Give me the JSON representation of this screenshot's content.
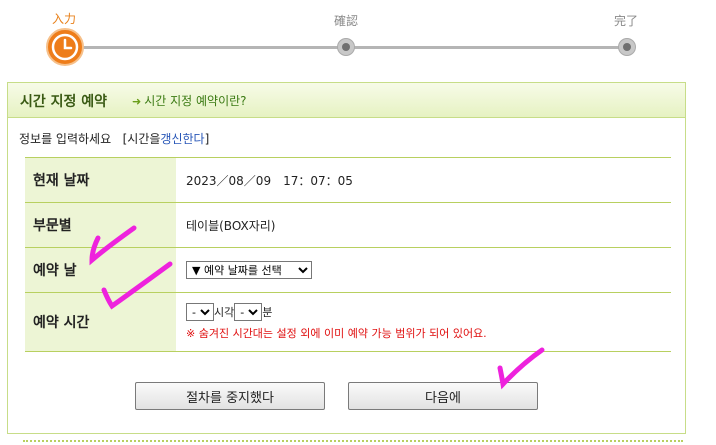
{
  "steps": {
    "input": "入力",
    "confirm": "確認",
    "done": "完了"
  },
  "panel": {
    "title": "시간 지정 예약",
    "help_link": "시간 지정 예약이란?"
  },
  "intro": {
    "text": "정보를 입력하세요",
    "refresh_prefix": "[시간을",
    "refresh_link": "갱신한다",
    "refresh_suffix": "]"
  },
  "rows": {
    "current_date": {
      "label": "현재 날짜",
      "value": "2023／08／09　17：07：05"
    },
    "section": {
      "label": "부문별",
      "value": "테이블(BOX자리)"
    },
    "reserve_date": {
      "label": "예약 날",
      "select": "▼ 예약 날짜를 선택"
    },
    "reserve_time": {
      "label": "예약 시간",
      "hour": "--",
      "hour_unit": "시각",
      "minute": "--",
      "minute_unit": "분",
      "note": "※ 숨겨진 시간대는 설정 외에 이미 예약 가능 범위가 되어 있어요."
    }
  },
  "buttons": {
    "cancel": "절차를 중지했다",
    "next": "다음에"
  },
  "colors": {
    "accent_orange": "#ee7d1a",
    "panel_green": "#c7dd88",
    "annotation_magenta": "#ee22dd",
    "note_red": "#e01010"
  }
}
